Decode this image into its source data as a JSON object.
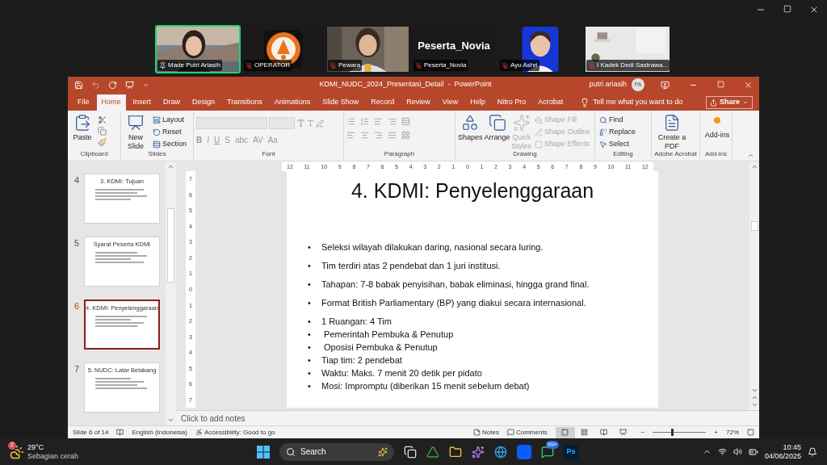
{
  "participants": [
    {
      "name": "Made Putri Ariasih",
      "kind": "video",
      "speaking": true,
      "pinned": true,
      "muted": false
    },
    {
      "name": "OPERATOR",
      "kind": "logo",
      "speaking": false,
      "pinned": false,
      "muted": true
    },
    {
      "name": "Pewara",
      "kind": "video",
      "speaking": false,
      "pinned": false,
      "muted": true
    },
    {
      "name": "Peserta_Novia",
      "kind": "name",
      "display": "Peserta_Novia",
      "speaking": false,
      "pinned": false,
      "muted": true
    },
    {
      "name": "Ayu Ashri",
      "speaking": false,
      "pinned": false,
      "muted": true
    },
    {
      "name": "I Kadek Dedi Sastrawa...",
      "kind": "room",
      "speaking": false,
      "pinned": false,
      "muted": true
    }
  ],
  "window": {
    "title": "KDMI_NUDC_2024_Presentasi_Detail  -  PowerPoint",
    "user": "putri ariasih",
    "avatar": "PA"
  },
  "tabs": [
    {
      "label": "File",
      "selected": false
    },
    {
      "label": "Home",
      "selected": true
    },
    {
      "label": "Insert",
      "selected": false
    },
    {
      "label": "Draw",
      "selected": false
    },
    {
      "label": "Design",
      "selected": false
    },
    {
      "label": "Transitions",
      "selected": false
    },
    {
      "label": "Animations",
      "selected": false
    },
    {
      "label": "Slide Show",
      "selected": false
    },
    {
      "label": "Record",
      "selected": false
    },
    {
      "label": "Review",
      "selected": false
    },
    {
      "label": "View",
      "selected": false
    },
    {
      "label": "Help",
      "selected": false
    },
    {
      "label": "Nitro Pro",
      "selected": false
    },
    {
      "label": "Acrobat",
      "selected": false
    }
  ],
  "tell_me": "Tell me what you want to do",
  "share": "Share",
  "ribbon": [
    {
      "kind": "clipboard",
      "label": "Clipboard",
      "items": [
        {
          "label": "Paste",
          "disabled": false
        }
      ]
    },
    {
      "kind": "slides",
      "label": "Slides",
      "items": [
        {
          "label": "New Slide",
          "disabled": false
        },
        {
          "label": "Layout",
          "disabled": false
        },
        {
          "label": "Reset",
          "disabled": false
        },
        {
          "label": "Section",
          "disabled": false
        }
      ]
    },
    {
      "kind": "font",
      "label": "Font",
      "items": [
        {
          "label": "B",
          "disabled": false
        },
        {
          "label": "I",
          "disabled": false
        },
        {
          "label": "U",
          "disabled": false
        },
        {
          "label": "S",
          "disabled": false
        },
        {
          "label": "abc",
          "disabled": false
        },
        {
          "label": "AV",
          "disabled": false
        },
        {
          "label": "Aa",
          "disabled": false
        }
      ]
    },
    {
      "kind": "paragraph",
      "label": "Paragraph"
    },
    {
      "kind": "drawing",
      "label": "Drawing",
      "items": [
        {
          "label": "Shapes",
          "disabled": false
        },
        {
          "label": "Arrange",
          "disabled": false
        },
        {
          "label": "Quick Styles",
          "disabled": true
        },
        {
          "label": "Shape Fill",
          "disabled": true
        },
        {
          "label": "Shape Outline",
          "disabled": true
        },
        {
          "label": "Shape Effects",
          "disabled": true
        }
      ]
    },
    {
      "kind": "editing",
      "label": "Editing",
      "items": [
        {
          "label": "Find",
          "disabled": false
        },
        {
          "label": "Replace",
          "disabled": false
        },
        {
          "label": "Select",
          "disabled": false
        }
      ]
    },
    {
      "kind": "acrobat",
      "label": "Adobe Acrobat",
      "items": [
        {
          "label": "Create a PDF",
          "disabled": false
        }
      ]
    },
    {
      "kind": "addins",
      "label": "Add-ins",
      "items": [
        {
          "label": "Add-ins",
          "disabled": false
        }
      ]
    }
  ],
  "thumbnails": [
    {
      "number": "4",
      "title": "3. KDMI: Tujuan",
      "selected": false
    },
    {
      "number": "5",
      "title": "Syarat Peserta KDMI",
      "selected": false
    },
    {
      "number": "6",
      "title": "4. KDMI: Penyelenggaraan",
      "selected": true
    },
    {
      "number": "7",
      "title": "5. NUDC: Latar Belakang",
      "selected": false
    }
  ],
  "ruler": {
    "horizontal": [
      "12",
      "11",
      "10",
      "9",
      "8",
      "7",
      "6",
      "5",
      "4",
      "3",
      "2",
      "1",
      "0",
      "1",
      "2",
      "3",
      "4",
      "5",
      "6",
      "7",
      "8",
      "9",
      "10",
      "11",
      "12"
    ],
    "vertical": [
      "7",
      "6",
      "5",
      "4",
      "3",
      "2",
      "1",
      "0",
      "1",
      "2",
      "3",
      "4",
      "5",
      "6",
      "7"
    ]
  },
  "slide": {
    "title": "4. KDMI: Penyelenggaraan",
    "bullet": "•",
    "paragraphs": [
      "Seleksi wilayah dilakukan daring, nasional secara luring.",
      "Tim terdiri atas 2 pendebat dan 1 juri institusi.",
      "Tahapan: 7-8 babak penyisihan, babak eliminasi, hingga grand final.",
      "Format British Parliamentary (BP) yang diakui secara internasional."
    ],
    "list": [
      "1 Ruangan: 4 Tim",
      " Pemerintah Pembuka & Penutup",
      " Oposisi Pembuka & Penutup",
      "Tiap tim: 2 pendebat",
      "Waktu: Maks. 7 menit 20 detik per pidato",
      "Mosi: Impromptu (diberikan 15 menit sebelum debat)"
    ]
  },
  "notes_placeholder": "Click to add notes",
  "status_bar": {
    "slide": "Slide 6 of 14",
    "language": "English (Indonesia)",
    "accessibility": "Accessibility: Good to go",
    "notes": "Notes",
    "comments": "Comments",
    "views": [
      {
        "selected": true
      },
      {
        "selected": false
      },
      {
        "selected": false
      },
      {
        "selected": false
      }
    ],
    "zoom_out": "−",
    "zoom_in": "+",
    "zoom": {
      "level": 0.35
    },
    "zoom_label": "72%"
  },
  "taskbar": {
    "temperature": "29°C",
    "weather": "Sebagian cerah",
    "weather_badge": "2",
    "search": "Search",
    "whatsapp_badge": "99+",
    "photoshop": "Ps",
    "time": "10:45",
    "date": "04/06/2025"
  }
}
